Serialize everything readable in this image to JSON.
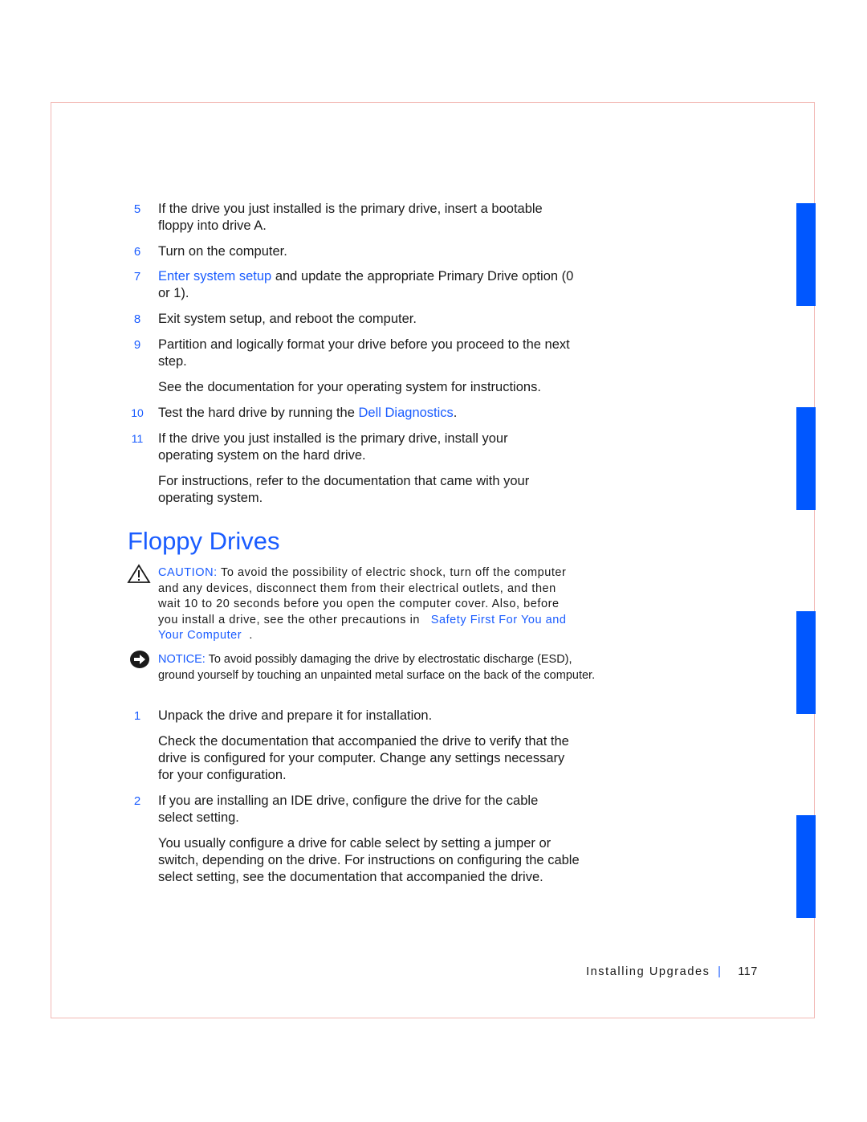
{
  "steps_top": [
    {
      "number": "5",
      "text": "If the drive you just installed is the primary drive, insert a bootable floppy into drive A."
    },
    {
      "number": "6",
      "text": "Turn on the computer."
    },
    {
      "number": "7",
      "link": "Enter system setup",
      "text_a": "and update the appropriate",
      "text_b": "Primary Drive",
      "text_c": "option (0 or 1)."
    },
    {
      "number": "8",
      "text": "Exit system setup, and reboot the computer."
    },
    {
      "number": "9",
      "text": "Partition and logically format your drive before you proceed to the next step.",
      "sub": "See the documentation for your operating system for instructions."
    },
    {
      "number": "10",
      "text": "Test the hard drive by running the",
      "link": "Dell Diagnostics",
      "text_end": "."
    },
    {
      "number": "11",
      "text": "If the drive you just installed is the primary drive, install your operating system on the hard drive.",
      "sub": "For instructions, refer to the documentation that came with your operating system."
    }
  ],
  "section": {
    "heading": "Floppy Drives",
    "caution": {
      "icon": "warning-triangle-icon",
      "label": "CAUTION:",
      "text": "To avoid the possibility of electric shock, turn off the computer and any devices, disconnect them from their electrical outlets, and then wait 10 to 20 seconds before you open the computer cover. Also, before you install a drive, see the other precautions in",
      "link": "Safety First For You and Your Computer",
      "end": "."
    },
    "notice": {
      "icon": "notice-arrow-icon",
      "label": "NOTICE:",
      "text": "To avoid possibly damaging the drive by electrostatic discharge (ESD), ground yourself by touching an unpainted metal surface on the back of the computer."
    },
    "steps": [
      {
        "number": "1",
        "text": "Unpack the drive and prepare it for installation.",
        "sub": "Check the documentation that accompanied the drive to verify that the drive is configured for your computer. Change any settings necessary for your configuration."
      },
      {
        "number": "2",
        "text": "If you are installing an IDE drive, configure the drive for the cable select setting.",
        "sub": "You usually configure a drive for cable select by setting a jumper or switch, depending on the drive. For instructions on configuring the cable select setting, see the documentation that accompanied the drive."
      }
    ]
  },
  "footer": {
    "chapter": "Installing Upgrades",
    "separator": "|",
    "page": "117"
  },
  "colors": {
    "accent": "#1a5cff",
    "tab": "#0057ff",
    "frame": "#f2b8b4"
  }
}
